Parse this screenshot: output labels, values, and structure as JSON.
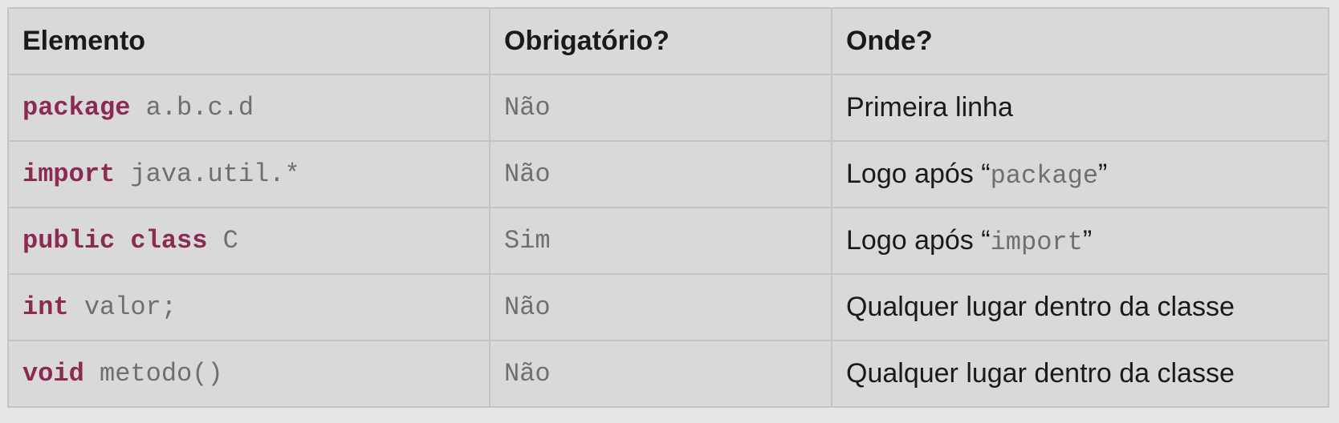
{
  "table": {
    "headers": [
      "Elemento",
      "Obrigatório?",
      "Onde?"
    ],
    "rows": [
      {
        "element_keywords": [
          "package"
        ],
        "element_rest": "a.b.c.d",
        "required": "Não",
        "where_text": "Primeira linha",
        "where_code": ""
      },
      {
        "element_keywords": [
          "import"
        ],
        "element_rest": "java.util.*",
        "required": "Não",
        "where_text": "Logo após “",
        "where_code": "package",
        "where_suffix": "”"
      },
      {
        "element_keywords": [
          "public",
          "class"
        ],
        "element_rest": "C",
        "required": "Sim",
        "where_text": "Logo após “",
        "where_code": "import",
        "where_suffix": "”"
      },
      {
        "element_keywords": [
          "int"
        ],
        "element_rest": "valor;",
        "required": "Não",
        "where_text": "Qualquer lugar dentro da classe",
        "where_code": ""
      },
      {
        "element_keywords": [
          "void"
        ],
        "element_rest": "metodo()",
        "required": "Não",
        "where_text": "Qualquer lugar dentro da classe",
        "where_code": ""
      }
    ]
  },
  "colors": {
    "keyword": "#8c2b52",
    "code": "#6f6f6f",
    "text": "#1a1a1a",
    "table_bg": "#d9d9d9",
    "border": "#c4c4c4"
  }
}
